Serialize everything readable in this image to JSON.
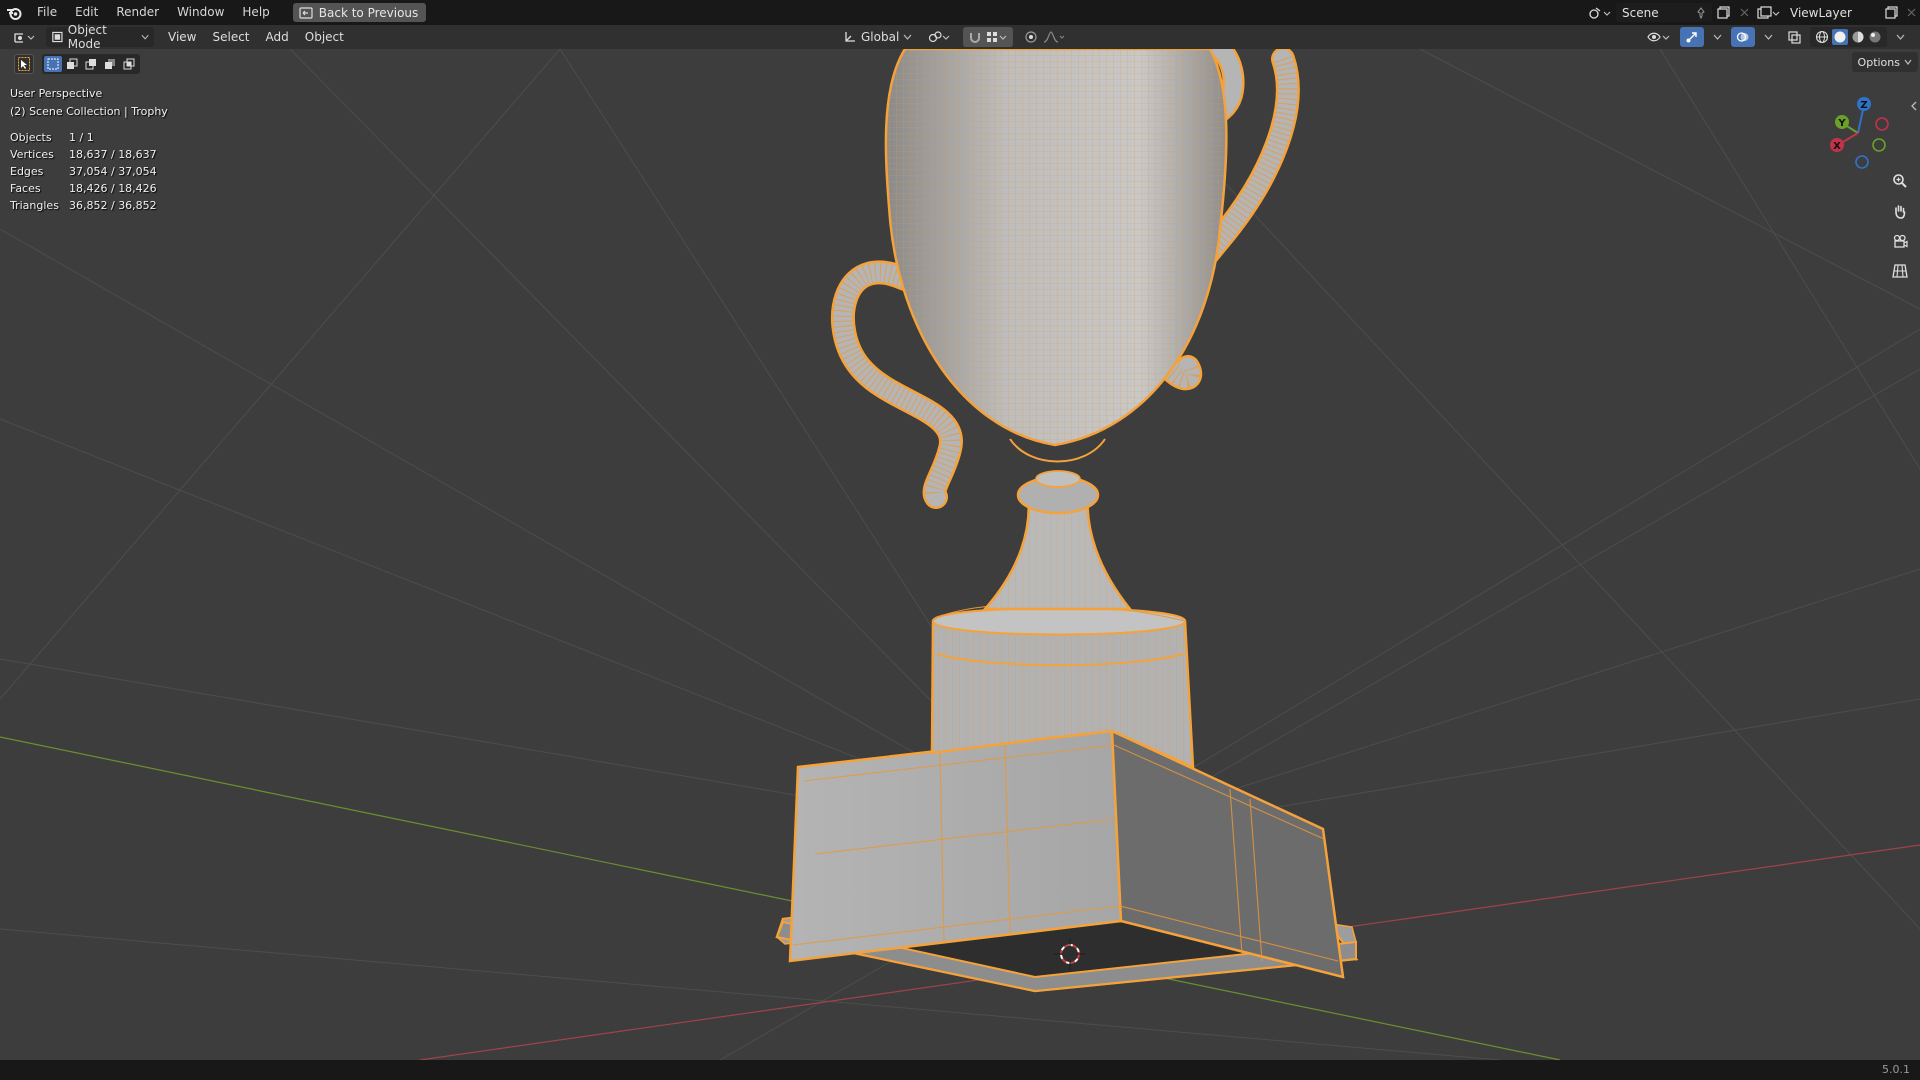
{
  "menu": {
    "items": [
      "File",
      "Edit",
      "Render",
      "Window",
      "Help"
    ],
    "back_button": "Back to Previous"
  },
  "scene": {
    "name": "Scene"
  },
  "view_layer": {
    "name": "ViewLayer"
  },
  "header": {
    "mode": "Object Mode",
    "menus": [
      "View",
      "Select",
      "Add",
      "Object"
    ],
    "transform_orientation": "Global"
  },
  "viewport": {
    "perspective": "User Perspective",
    "collection": "(2) Scene Collection | Trophy",
    "options_label": "Options",
    "stats": [
      {
        "label": "Objects",
        "value": "1 / 1"
      },
      {
        "label": "Vertices",
        "value": "18,637 / 18,637"
      },
      {
        "label": "Edges",
        "value": "37,054 / 37,054"
      },
      {
        "label": "Faces",
        "value": "18,426 / 18,426"
      },
      {
        "label": "Triangles",
        "value": "36,852 / 36,852"
      }
    ],
    "gizmo_axes": {
      "x": "X",
      "y": "Y",
      "z": "Z"
    }
  },
  "colors": {
    "selection_orange": "#f5a23b",
    "axis_x": "#c2334a",
    "axis_y": "#6ba029",
    "axis_z": "#2f73c9",
    "accent_blue": "#4772b3"
  },
  "status": {
    "version": "5.0.1"
  }
}
